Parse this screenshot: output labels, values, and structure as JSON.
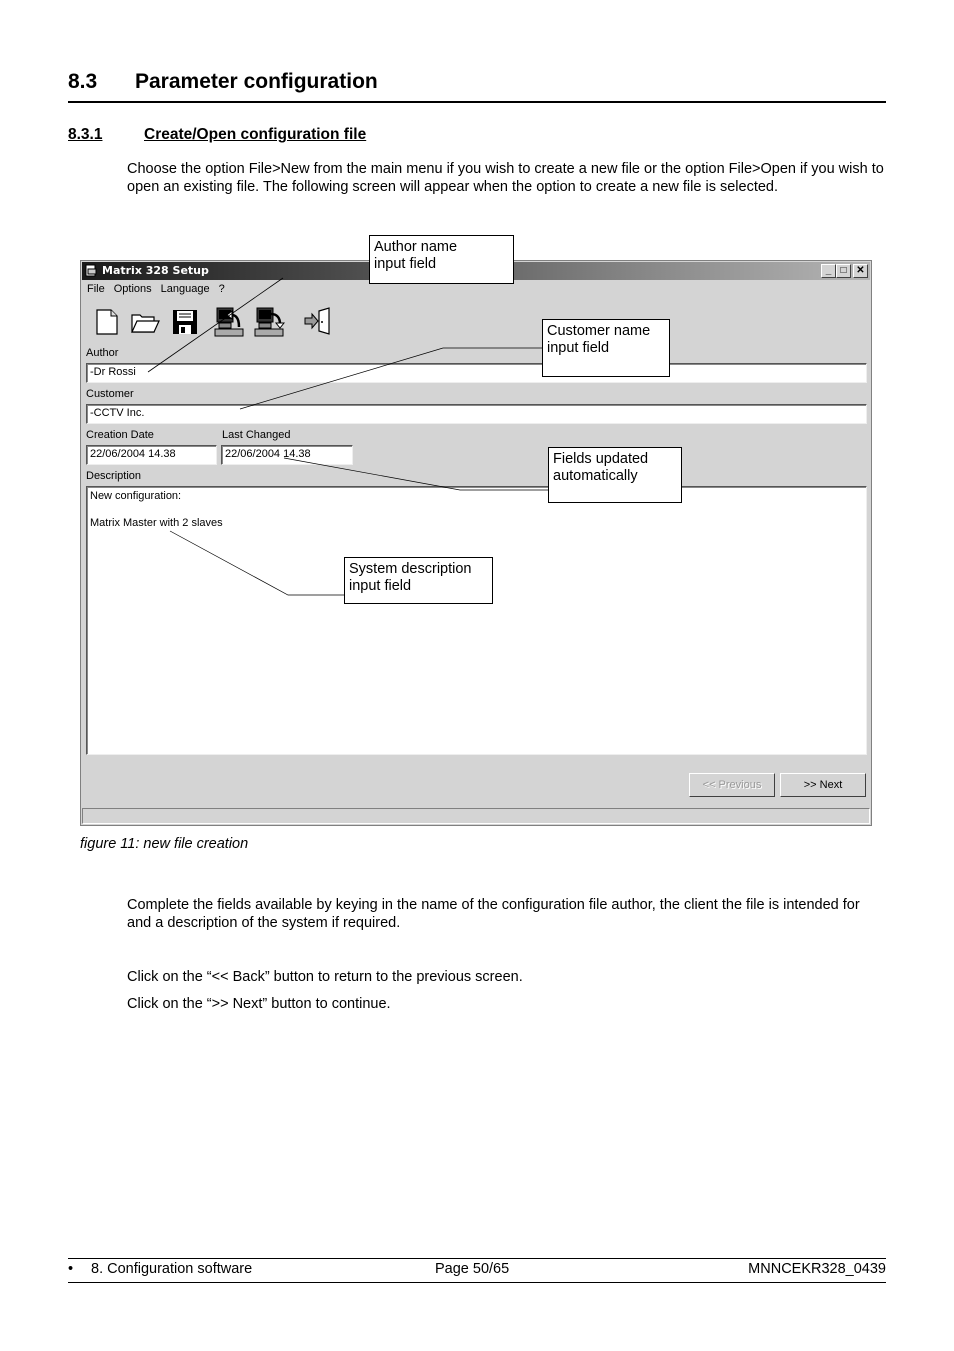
{
  "section": {
    "number": "8.3",
    "title": "Parameter configuration"
  },
  "subsection": {
    "number": "8.3.1",
    "title": "Create/Open configuration file"
  },
  "intro_paragraph": "Choose the option File>New from the main menu if you wish to create a new file or the option File>Open if you wish to open an existing file. The following screen will appear when the option to create a new file is selected.",
  "window": {
    "title": "Matrix 328 Setup",
    "controls": {
      "minimize": "_",
      "maximize": "□",
      "close": "✕"
    },
    "menu": [
      "File",
      "Options",
      "Language",
      "?"
    ],
    "toolbar": [
      {
        "name": "new-file-icon",
        "tooltip": "New"
      },
      {
        "name": "open-folder-icon",
        "tooltip": "Open"
      },
      {
        "name": "save-disk-icon",
        "tooltip": "Save"
      },
      {
        "name": "receive-from-device-icon",
        "tooltip": "Download"
      },
      {
        "name": "send-to-device-icon",
        "tooltip": "Upload"
      },
      {
        "name": "exit-door-icon",
        "tooltip": "Exit"
      }
    ],
    "author": {
      "label": "Author",
      "value": "-Dr Rossi"
    },
    "customer": {
      "label": "Customer",
      "value": "-CCTV Inc."
    },
    "creation_date": {
      "label": "Creation Date",
      "value": "22/06/2004 14.38"
    },
    "last_changed": {
      "label": "Last Changed",
      "value": "22/06/2004 14.38"
    },
    "description": {
      "label": "Description",
      "value": "New configuration:\n\nMatrix Master with 2 slaves"
    },
    "buttons": {
      "previous": "<< Previous",
      "next": ">> Next"
    },
    "status": ""
  },
  "callouts": {
    "author": "Author name\n input field",
    "customer": "Customer name\ninput field",
    "dates": "Fields updated\nautomatically",
    "description": "System description\ninput field"
  },
  "figure_caption": "figure 11: new file creation",
  "body_paragraph": "Complete the fields available by keying in the name of the configuration file author, the client the file is intended for and a description of the system if required.",
  "instructions": [
    "Click on the “<<  Back” button to return to the previous screen.",
    "Click on the “>>  Next” button to continue."
  ],
  "footer": {
    "bullet": "•",
    "chapter": "8. Configuration software",
    "page": "Page 50/65",
    "doc_code": "MNNCEKR328_0439"
  }
}
